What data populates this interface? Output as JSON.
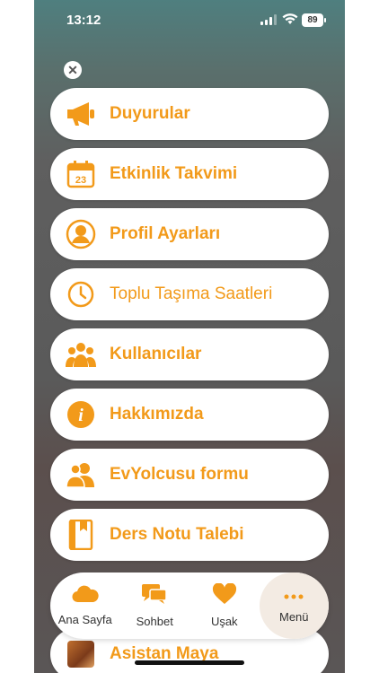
{
  "status": {
    "time": "13:12",
    "battery": "89"
  },
  "menu": [
    {
      "label": "Duyurular",
      "icon": "megaphone-icon"
    },
    {
      "label": "Etkinlik Takvimi",
      "icon": "calendar-icon",
      "icon_text": "23"
    },
    {
      "label": "Profil Ayarları",
      "icon": "profile-icon"
    },
    {
      "label": "Toplu Taşıma Saatleri",
      "icon": "clock-icon"
    },
    {
      "label": "Kullanıcılar",
      "icon": "users-icon"
    },
    {
      "label": "Hakkımızda",
      "icon": "info-icon",
      "icon_text": "i"
    },
    {
      "label": "EvYolcusu formu",
      "icon": "group-icon"
    },
    {
      "label": "Ders Notu Talebi",
      "icon": "book-icon"
    },
    {
      "label": "Asistan Maya",
      "icon": "avatar-icon"
    }
  ],
  "tabs": [
    {
      "label": "Ana Sayfa",
      "icon": "cloud-icon",
      "active": false
    },
    {
      "label": "Sohbet",
      "icon": "chat-icon",
      "active": false
    },
    {
      "label": "Uşak",
      "icon": "heart-icon",
      "active": false
    },
    {
      "label": "Menü",
      "icon": "more-icon",
      "active": true
    }
  ],
  "colors": {
    "accent": "#f29a1a",
    "tab_active_bg": "#f3ebe3"
  }
}
